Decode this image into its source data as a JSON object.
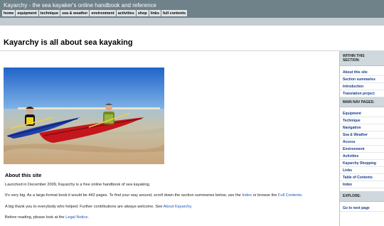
{
  "header": {
    "site_title": "Kayarchy - the sea kayaker's online handbook and reference",
    "nav": [
      "home",
      "equipment",
      "technique",
      "sea & weather",
      "environment",
      "activities",
      "shop",
      "links",
      "full contents"
    ]
  },
  "main": {
    "page_title": "Kayarchy is all about sea kayaking",
    "section_heading": "About this site",
    "p1": "Launched in December 2009, Kayarchy is a free online handbook of sea kayaking.",
    "p2_before": "It's very big. As a large-format book it would be 442 pages. To find your way around, scroll down the section summaries below, use the ",
    "p2_link1": "Index",
    "p2_middle": " or browse the ",
    "p2_link2": "Full Contents",
    "p2_after": ".",
    "p3_before": "A big thank you to everybody who helped. Further contributions are always welcome. See ",
    "p3_link": "About Kayarchy",
    "p3_after": ".",
    "p4_before": "Before reading, please look at the ",
    "p4_link": "Legal Notice",
    "p4_after": "."
  },
  "sidebar": {
    "section_heading_1": "WITHIN THIS SECTION:",
    "section_items": [
      "About this site",
      "Section summaries",
      "Introduction",
      "Translation project"
    ],
    "section_heading_2": "MAIN NAV PAGES:",
    "nav_items": [
      "Equipment",
      "Technique",
      "Navigation",
      "Sea & Weather",
      "Access",
      "Environment",
      "Activities",
      "Kayarchy Shopping",
      "Links",
      "Table of Contents",
      "Index"
    ],
    "section_heading_3": "EXPLORE:",
    "explore_items": [
      "Go to next page"
    ]
  },
  "colors": {
    "topbar": "#6f8189",
    "nav_button": "#dfe5e8",
    "link": "#1a55b8",
    "sidebar_heading_bg": "#cfd9dd"
  }
}
